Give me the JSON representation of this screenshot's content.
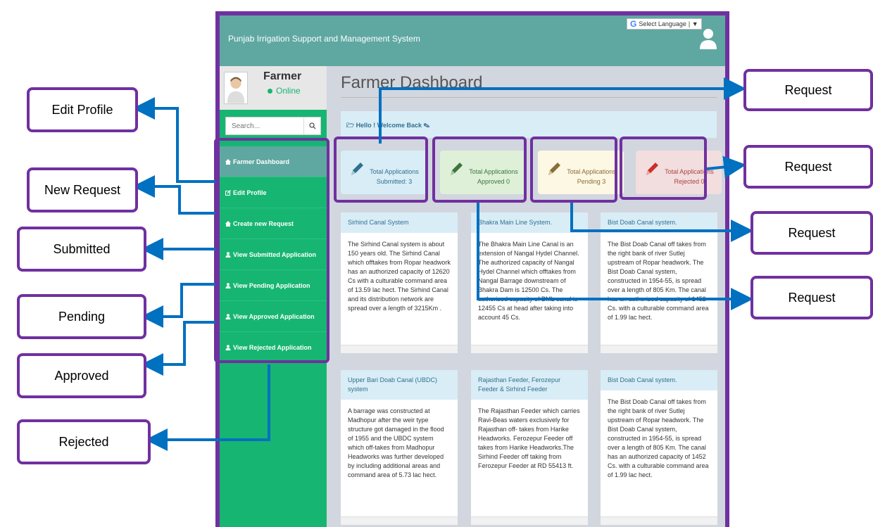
{
  "app": {
    "title": "Punjab Irrigation Support and Management System",
    "language_label": "Select Language"
  },
  "profile": {
    "name": "Farmer",
    "status": "Online"
  },
  "search": {
    "placeholder": "Search..."
  },
  "menu": [
    {
      "label": "Farmer Dashboard",
      "icon": "dashboard-icon",
      "active": true
    },
    {
      "label": "Edit Profile",
      "icon": "edit-icon"
    },
    {
      "label": "Create new Request",
      "icon": "dashboard-icon"
    },
    {
      "label": "View Submitted Application",
      "icon": "user-icon"
    },
    {
      "label": "View Pending Application",
      "icon": "user-icon"
    },
    {
      "label": "View Approved Application",
      "icon": "user-icon"
    },
    {
      "label": "View Rejected Application",
      "icon": "user-icon"
    }
  ],
  "page": {
    "title": "Farmer Dashboard",
    "welcome": "Hello ! Welcome Back"
  },
  "stats": [
    {
      "line1": "Total Applications",
      "line2": "Submitted: 3",
      "color": "#31708f"
    },
    {
      "line1": "Total Applications",
      "line2": "Approved 0",
      "color": "#3c763d"
    },
    {
      "line1": "Total Applications",
      "line2": "Pending 3",
      "color": "#8a6d3b"
    },
    {
      "line1": "Total Applications",
      "line2": "Rejected 0",
      "color": "#a94442"
    }
  ],
  "cards": [
    {
      "title": "Sirhind Canal System",
      "body": "The Sirhind Canal system is about 150 years old. The Sirhind Canal which offtakes from Ropar headwork has an authorized capacity of 12620 Cs with a culturable command area of 13.59 lac hect. The Sirhind Canal and its distribution network are spread over a length of 3215Km ."
    },
    {
      "title": "Bhakra Main Line System.",
      "body": "The Bhakra Main Line Canal is an extension of Nangal Hydel Channel. The authorized capacity of Nangal Hydel Channel which offtakes from Nangal Barrage downstream of Bhakra Dam is 12500 Cs. The authorized capacity of BML canal is 12455 Cs at head after taking into account 45 Cs."
    },
    {
      "title": "Bist Doab Canal system.",
      "body": "The Bist Doab Canal off takes from the right bank of river Sutlej upstream of Ropar headwork. The Bist Doab Canal system, constructed in 1954-55, is spread over a length of 805 Km. The canal has an authorized capacity of 1452 Cs. with a culturable command area of 1.99 lac hect."
    },
    {
      "title": "Upper Bari Doab Canal (UBDC) system",
      "body": "A barrage was constructed at Madhopur after the weir type structure got damaged in the flood of 1955 and the UBDC system which off-takes from Madhopur Headworks was further developed by including additional areas and command area of 5.73 lac hect."
    },
    {
      "title": "Rajasthan Feeder, Ferozepur Feeder & Sirhind Feeder",
      "body": "The Rajasthan Feeder which carries Ravi-Beas waters exclusively for Rajasthan off- takes from Harike Headworks. Ferozepur Feeder off takes from Harike Headworks.The Sirhind Feeder off taking from Ferozepur Feeder at RD 55413 ft."
    },
    {
      "title": "Bist Doab Canal system.",
      "body": "The Bist Doab Canal off takes from the right bank of river Sutlej upstream of Ropar headwork. The Bist Doab Canal system, constructed in 1954-55, is spread over a length of 805 Km. The canal has an authorized capacity of 1452 Cs. with a culturable command area of 1.99 lac hect."
    }
  ],
  "annotations": {
    "left": [
      "Edit Profile",
      "New Request",
      "Submitted",
      "Pending",
      "Approved",
      "Rejected"
    ],
    "right": [
      "Request",
      "Request",
      "Request",
      "Request"
    ]
  },
  "colors": {
    "annotation_border": "#7030a0",
    "arrow": "#0070c0",
    "topbar": "#5fa8a1",
    "sidebar": "#17b572"
  }
}
